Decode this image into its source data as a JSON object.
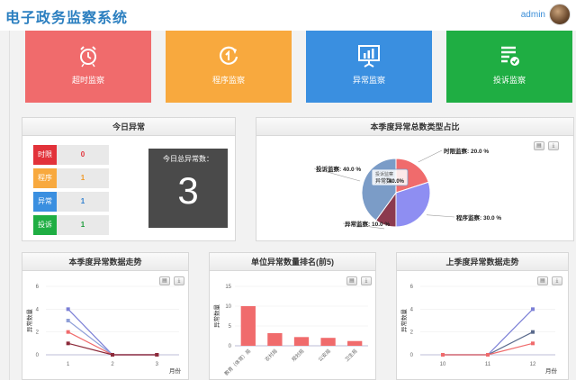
{
  "header": {
    "title": "电子政务监察系统",
    "user": "admin"
  },
  "tiles": [
    {
      "label": "超时监察",
      "icon": "alarm-clock-icon",
      "color": "#f06b6c"
    },
    {
      "label": "程序监察",
      "icon": "refresh-cycle-icon",
      "color": "#f8a93e"
    },
    {
      "label": "异常监察",
      "icon": "presentation-chart-icon",
      "color": "#3a8fe0"
    },
    {
      "label": "投诉监察",
      "icon": "complaint-list-icon",
      "color": "#1fae43"
    }
  ],
  "today": {
    "title": "今日异常",
    "items": [
      {
        "tag": "时限",
        "value": "0",
        "color": "#e2323a",
        "text_color": "#e2323a"
      },
      {
        "tag": "程序",
        "value": "1",
        "color": "#f8a93e",
        "text_color": "#f09a28"
      },
      {
        "tag": "异常",
        "value": "1",
        "color": "#3a8fe0",
        "text_color": "#2f7fd0"
      },
      {
        "tag": "投诉",
        "value": "1",
        "color": "#1fae43",
        "text_color": "#1d9c3b"
      }
    ],
    "total_label": "今日总异常数：",
    "total_value": "3"
  },
  "charts": {
    "pie": {
      "type": "pie",
      "title": "本季度异常总数类型占比",
      "slices": [
        {
          "name": "时限监察",
          "label": "时限监察: 20.0 %",
          "value": 20.0,
          "color": "#f06b6c"
        },
        {
          "name": "程序监察",
          "label": "程序监察: 30.0 %",
          "value": 30.0,
          "color": "#8e8ef2"
        },
        {
          "name": "异常监察",
          "label": "异常监察: 10.0 %",
          "value": 10.0,
          "color": "#8c3a4e"
        },
        {
          "name": "投诉监察",
          "label": "投诉监察: 40.0 %",
          "value": 40.0,
          "color": "#7b9cc7"
        }
      ],
      "tooltip": {
        "title": "投诉监察",
        "key": "异常数:",
        "value": "40.0%"
      }
    },
    "trend1": {
      "type": "line",
      "title": "本季度异常数据走势",
      "ylabel": "异常数量",
      "xlabel": "月份",
      "x": [
        "1",
        "2",
        "3"
      ],
      "ylim": [
        0,
        6
      ],
      "yticks": [
        "0",
        "2",
        "4",
        "6"
      ],
      "series": [
        {
          "values": [
            4,
            0,
            0
          ],
          "color": "#7b7fd6"
        },
        {
          "values": [
            3,
            0,
            0
          ],
          "color": "#8f9fd8"
        },
        {
          "values": [
            2,
            0,
            0
          ],
          "color": "#f06b6c"
        },
        {
          "values": [
            1,
            0,
            0
          ],
          "color": "#8c2a3a"
        }
      ]
    },
    "rank": {
      "type": "bar",
      "title": "单位异常数量排名(前5)",
      "ylabel": "异常数量",
      "categories": [
        "教育（体育）局",
        "农村局",
        "规划局",
        "公安局",
        "卫生局"
      ],
      "values": [
        10,
        3.2,
        2.2,
        2.0,
        1.2
      ],
      "ylim": [
        0,
        15
      ],
      "yticks": [
        "0",
        "5",
        "10",
        "15"
      ],
      "color": "#f06b6c"
    },
    "trend2": {
      "type": "line",
      "title": "上季度异常数据走势",
      "ylabel": "异常数量",
      "xlabel": "月份",
      "x": [
        "10",
        "11",
        "12"
      ],
      "ylim": [
        0,
        6
      ],
      "yticks": [
        "0",
        "2",
        "4",
        "6"
      ],
      "series": [
        {
          "values": [
            0,
            0,
            4
          ],
          "color": "#7b7fd6"
        },
        {
          "values": [
            0,
            0,
            2
          ],
          "color": "#5a6a8c"
        },
        {
          "values": [
            0,
            0,
            1
          ],
          "color": "#f06b6c"
        }
      ]
    }
  }
}
